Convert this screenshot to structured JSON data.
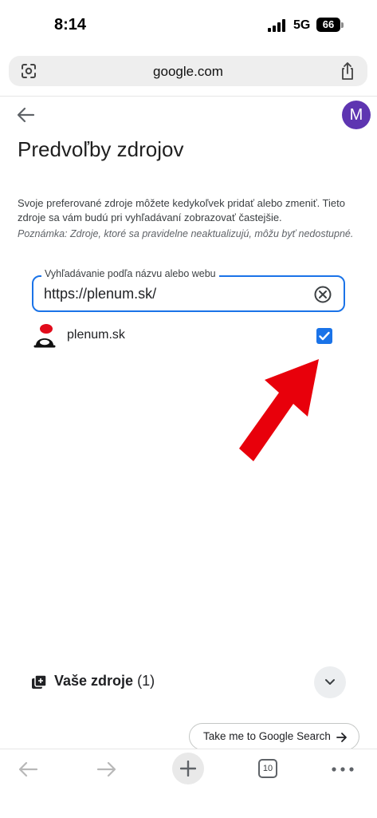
{
  "status_bar": {
    "time": "8:14",
    "network": "5G",
    "battery": "66"
  },
  "browser": {
    "url": "google.com"
  },
  "account": {
    "avatar_initial": "M"
  },
  "page": {
    "title": "Predvoľby zdrojov",
    "description": "Svoje preferované zdroje môžete kedykoľvek pridať alebo zmeniť. Tieto zdroje sa vám budú pri vyhľadávaní zobrazovať častejšie.",
    "note": "Poznámka: Zdroje, ktoré sa pravidelne neaktualizujú, môžu byť nedostupné."
  },
  "search": {
    "label": "Vyhľadávanie podľa názvu alebo webu",
    "value": "https://plenum.sk/"
  },
  "results": [
    {
      "name": "plenum.sk",
      "checked": true
    }
  ],
  "your_sources": {
    "label": "Vaše zdroje",
    "count": "(1)"
  },
  "google_search_button": {
    "label": "Take me to Google Search"
  },
  "toolbar": {
    "tab_count": "10"
  },
  "colors": {
    "accent": "#1a73e8",
    "avatar": "#5e35b1",
    "annotation_arrow": "#e8000b"
  },
  "icons": [
    "lens-icon",
    "share-icon",
    "back-arrow-icon",
    "clear-icon",
    "checkmark-icon",
    "your-sources-icon",
    "chevron-down-icon",
    "arrow-right-icon",
    "browser-back-icon",
    "browser-forward-icon",
    "plus-icon",
    "tabs-icon",
    "more-icon"
  ]
}
